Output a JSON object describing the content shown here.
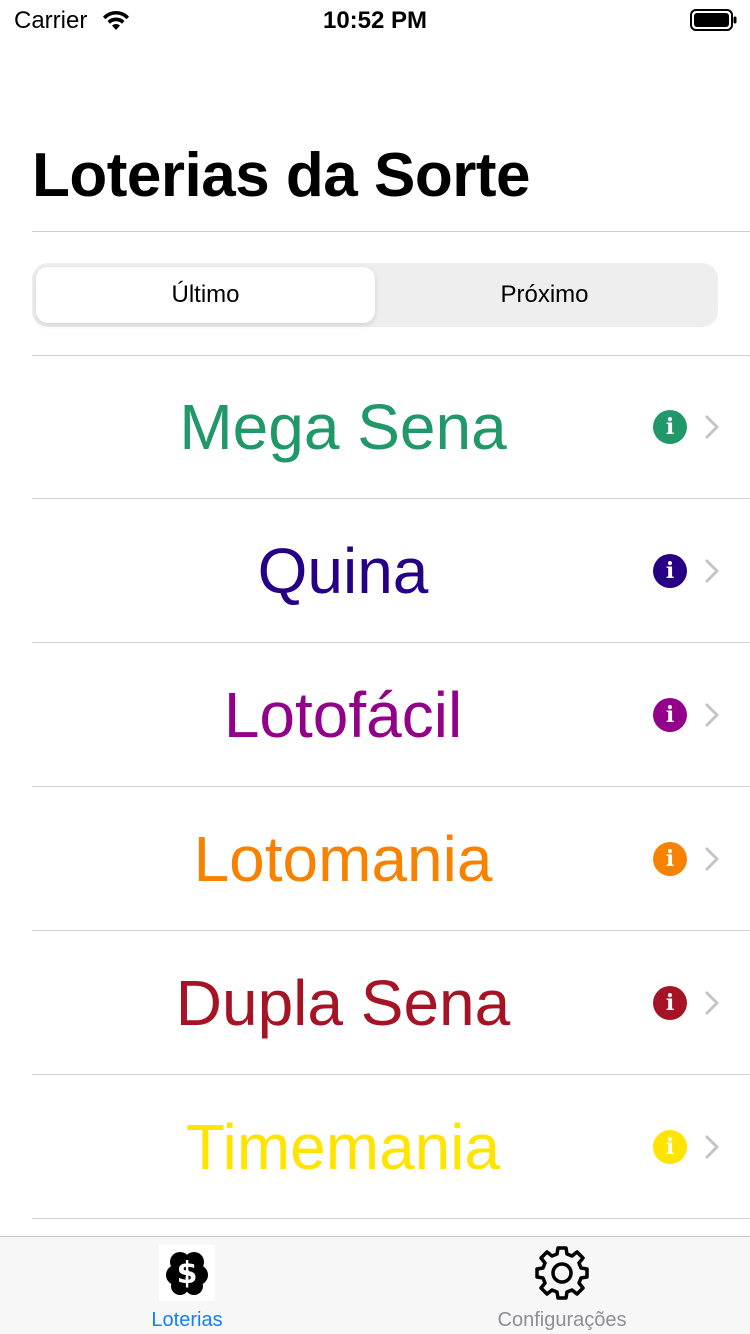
{
  "status_bar": {
    "carrier": "Carrier",
    "time": "10:52 PM",
    "wifi_icon": "wifi-icon",
    "battery_icon": "battery-icon"
  },
  "title": "Loterias da Sorte",
  "segmented_control": {
    "segments": [
      "Último",
      "Próximo"
    ],
    "selected": "Último"
  },
  "lotteries": [
    {
      "name": "Mega Sena",
      "color": "#209869"
    },
    {
      "name": "Quina",
      "color": "#260085"
    },
    {
      "name": "Lotofácil",
      "color": "#930089"
    },
    {
      "name": "Lotomania",
      "color": "#F78100"
    },
    {
      "name": "Dupla Sena",
      "color": "#A61324"
    },
    {
      "name": "Timemania",
      "color": "#FFE400"
    }
  ],
  "row_icons": {
    "info": "info-icon",
    "chevron": "chevron-right-icon"
  },
  "tab_bar": {
    "tabs": [
      {
        "label": "Loterias",
        "icon": "lottery-clover-icon",
        "active": true,
        "color": "#147EFB"
      },
      {
        "label": "Configurações",
        "icon": "gear-icon",
        "active": false,
        "color": "#8E8E93"
      }
    ]
  }
}
